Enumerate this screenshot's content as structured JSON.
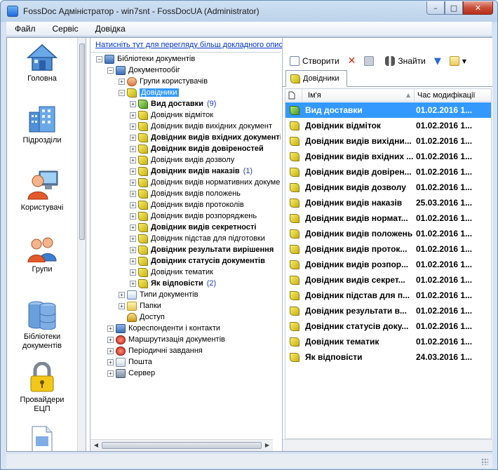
{
  "window": {
    "title": "FossDoc Адміністратор - win7snt - FossDocUA (Administrator)",
    "buttons": {
      "minimize": "–",
      "maximize": "□",
      "close": "✕"
    }
  },
  "menu": [
    {
      "label": "Файл"
    },
    {
      "label": "Сервіс"
    },
    {
      "label": "Довідка"
    }
  ],
  "nav": [
    {
      "label": "Головна",
      "icon": "house-icon"
    },
    {
      "label": "Підрозділи",
      "icon": "building-icon"
    },
    {
      "label": "Користувачі",
      "icon": "user-icon"
    },
    {
      "label": "Групи",
      "icon": "users-icon"
    },
    {
      "label": "Бібліотеки документів",
      "icon": "database-icon"
    },
    {
      "label": "Провайдери ЕЦП",
      "icon": "lock-icon"
    },
    {
      "label": "",
      "icon": "document-icon"
    }
  ],
  "hint_link": "Натисніть тут для перегляду більш докладного опису",
  "tree": [
    {
      "label": "Бібліотеки документів",
      "level": 0,
      "exp": "−",
      "icon": "lib"
    },
    {
      "label": "Документообіг",
      "level": 1,
      "exp": "−",
      "icon": "lib"
    },
    {
      "label": "Групи користувачів",
      "level": 2,
      "exp": "+",
      "icon": "users"
    },
    {
      "label": "Довідники",
      "level": 2,
      "exp": "−",
      "icon": "book",
      "selected": true
    },
    {
      "label": "Вид доставки",
      "level": 3,
      "exp": "+",
      "icon": "green",
      "bold": true,
      "count": "(9)"
    },
    {
      "label": "Довідник відміток",
      "level": 3,
      "exp": "+",
      "icon": "book"
    },
    {
      "label": "Довідник видів вихідних документ",
      "level": 3,
      "exp": "+",
      "icon": "book"
    },
    {
      "label": "Довідник видів вхідних документів",
      "level": 3,
      "exp": "+",
      "icon": "book",
      "bold": true
    },
    {
      "label": "Довідник видів довіреностей",
      "level": 3,
      "exp": "+",
      "icon": "book",
      "bold": true
    },
    {
      "label": "Довідник видів дозволу",
      "level": 3,
      "exp": "+",
      "icon": "book"
    },
    {
      "label": "Довідник видів наказів",
      "level": 3,
      "exp": "+",
      "icon": "book",
      "bold": true,
      "count": "(1)"
    },
    {
      "label": "Довідник видів нормативних документів",
      "level": 3,
      "exp": "+",
      "icon": "book"
    },
    {
      "label": "Довідник видів положень",
      "level": 3,
      "exp": "+",
      "icon": "book"
    },
    {
      "label": "Довідник видів протоколів",
      "level": 3,
      "exp": "+",
      "icon": "book"
    },
    {
      "label": "Довідник видів розпоряджень",
      "level": 3,
      "exp": "+",
      "icon": "book"
    },
    {
      "label": "Довідник видів секретності",
      "level": 3,
      "exp": "+",
      "icon": "book",
      "bold": true
    },
    {
      "label": "Довідник підстав для підготовки",
      "level": 3,
      "exp": "+",
      "icon": "book"
    },
    {
      "label": "Довідник результати вирішення",
      "level": 3,
      "exp": "+",
      "icon": "book",
      "bold": true
    },
    {
      "label": "Довідник статусів документів",
      "level": 3,
      "exp": "+",
      "icon": "book",
      "bold": true
    },
    {
      "label": "Довідник тематик",
      "level": 3,
      "exp": "+",
      "icon": "book"
    },
    {
      "label": "Як відповісти",
      "level": 3,
      "exp": "+",
      "icon": "book",
      "bold": true,
      "count": "(2)"
    },
    {
      "label": "Типи документів",
      "level": 2,
      "exp": "+",
      "icon": "types"
    },
    {
      "label": "Папки",
      "level": 2,
      "exp": "+",
      "icon": "folder"
    },
    {
      "label": "Доступ",
      "level": 2,
      "exp": "",
      "icon": "access"
    },
    {
      "label": "Кореспонденти і контакти",
      "level": 1,
      "exp": "+",
      "icon": "lib"
    },
    {
      "label": "Маршрутизація документів",
      "level": 1,
      "exp": "+",
      "icon": "route"
    },
    {
      "label": "Періодичні завдання",
      "level": 1,
      "exp": "+",
      "icon": "route"
    },
    {
      "label": "Пошта",
      "level": 1,
      "exp": "+",
      "icon": "mail"
    },
    {
      "label": "Сервер",
      "level": 1,
      "exp": "+",
      "icon": "server"
    }
  ],
  "toolbar": {
    "create": "Створити",
    "find": "Знайти"
  },
  "tab_label": "Довідники",
  "grid": {
    "col_name": "Ім'я",
    "col_date": "Час модифікації",
    "rows": [
      {
        "name": "Вид доставки",
        "date": "01.02.2016 1...",
        "selected": true,
        "icon": "green"
      },
      {
        "name": "Довідник відміток",
        "date": "01.02.2016 1...",
        "icon": "book"
      },
      {
        "name": "Довідник видів вихідни...",
        "date": "01.02.2016 1...",
        "icon": "book"
      },
      {
        "name": "Довідник видів вхідних ...",
        "date": "01.02.2016 1...",
        "icon": "book"
      },
      {
        "name": "Довідник видів довірен...",
        "date": "01.02.2016 1...",
        "icon": "book"
      },
      {
        "name": "Довідник видів дозволу",
        "date": "01.02.2016 1...",
        "icon": "book"
      },
      {
        "name": "Довідник видів наказів",
        "date": "25.03.2016 1...",
        "icon": "book"
      },
      {
        "name": "Довідник видів нормат...",
        "date": "01.02.2016 1...",
        "icon": "book"
      },
      {
        "name": "Довідник видів положень",
        "date": "01.02.2016 1...",
        "icon": "book"
      },
      {
        "name": "Довідник видів проток...",
        "date": "01.02.2016 1...",
        "icon": "book"
      },
      {
        "name": "Довідник видів розпор...",
        "date": "01.02.2016 1...",
        "icon": "book"
      },
      {
        "name": "Довідник видів секрет...",
        "date": "01.02.2016 1...",
        "icon": "book"
      },
      {
        "name": "Довідник підстав для п...",
        "date": "01.02.2016 1...",
        "icon": "book"
      },
      {
        "name": "Довідник результати в...",
        "date": "01.02.2016 1...",
        "icon": "book"
      },
      {
        "name": "Довідник статусів доку...",
        "date": "01.02.2016 1...",
        "icon": "book"
      },
      {
        "name": "Довідник тематик",
        "date": "01.02.2016 1...",
        "icon": "book"
      },
      {
        "name": "Як відповісти",
        "date": "24.03.2016 1...",
        "icon": "book"
      }
    ]
  }
}
